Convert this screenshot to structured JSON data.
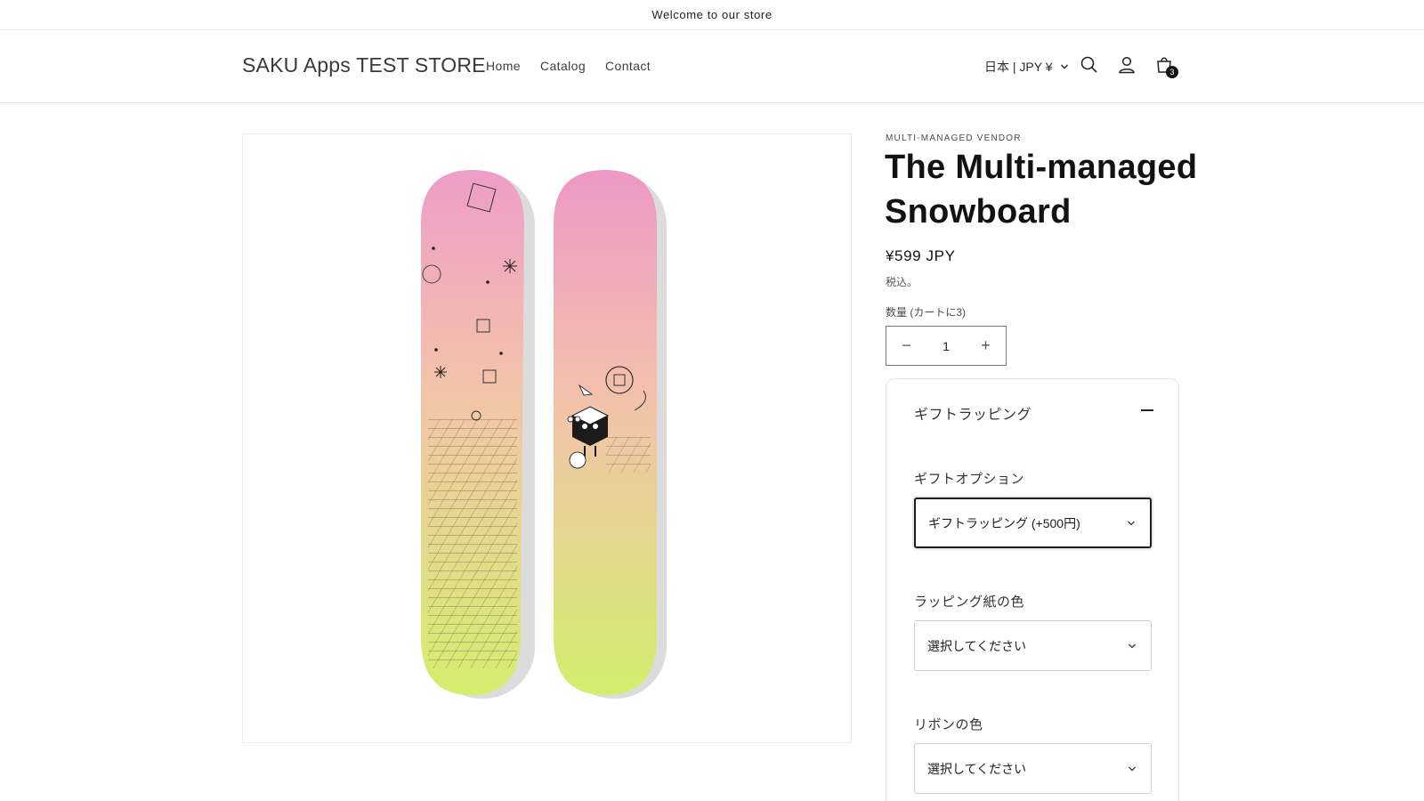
{
  "announcement": {
    "text": "Welcome to our store"
  },
  "header": {
    "store_name": "SAKU Apps TEST STORE",
    "nav": [
      "Home",
      "Catalog",
      "Contact"
    ],
    "locale": "日本 | JPY ¥",
    "cart_count": "3",
    "icons": [
      "search-icon",
      "account-icon",
      "cart-icon",
      "chevron-down-icon"
    ]
  },
  "product": {
    "vendor": "MULTI-MANAGED VENDOR",
    "title": "The Multi-managed Snowboard",
    "price": "¥599 JPY",
    "tax_note": "税込。",
    "quantity_label": "数量 (カートに3)",
    "quantity": "1",
    "decrement_symbol": "−",
    "increment_symbol": "+"
  },
  "gift": {
    "heading": "ギフトラッピング",
    "option_label": "ギフトオプション",
    "option_value": "ギフトラッピング (+500円)",
    "paper_label": "ラッピング紙の色",
    "paper_value": "選択してください",
    "ribbon_label": "リボンの色",
    "ribbon_value": "選択してください"
  },
  "colors": {
    "board_pink": "#f0a0c8",
    "board_peach": "#f3c4a8",
    "board_lime": "#d8ec78",
    "text": "#121212"
  }
}
